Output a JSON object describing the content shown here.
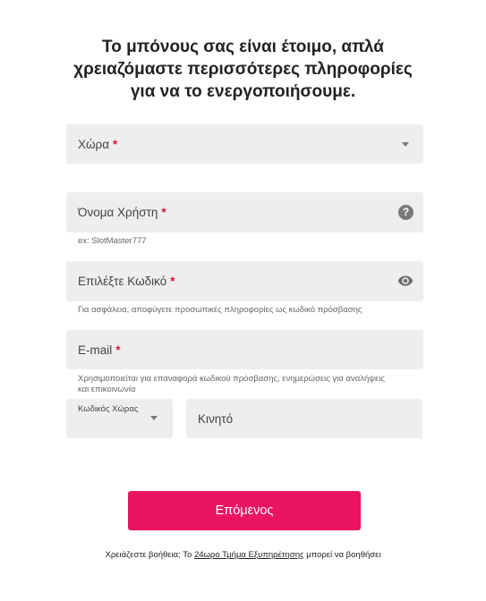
{
  "heading": {
    "line1": "Το μπόνους σας είναι έτοιμο, απλά",
    "line2": "χρειαζόμαστε περισσότερες πληροφορίες",
    "line3": "για να το ενεργοποιήσουμε."
  },
  "form": {
    "country": {
      "label": "Χώρα",
      "required_mark": "*"
    },
    "username": {
      "label": "Όνομα Χρήστη",
      "required_mark": "*",
      "hint": "ex: SlotMaster777",
      "help_icon": "question-circle-icon",
      "help_glyph": "?"
    },
    "password": {
      "label": "Επιλέξτε Κωδικό",
      "required_mark": "*",
      "hint": "Για ασφάλεια, αποφύγετε προσωπικές πληροφορίες ως κωδικό πρόσβασης",
      "toggle_icon": "eye-icon"
    },
    "email": {
      "label": "E-mail",
      "required_mark": "*",
      "hint_line1": "Χρησιμοποιείται για επαναφορά κωδικού πρόσβασης, ενημερώσεις για αναλήψεις",
      "hint_line2": "και επικοινωνία"
    },
    "country_code": {
      "label": "Κωδικός Χώρας"
    },
    "mobile": {
      "label": "Κινητό"
    }
  },
  "next_button": {
    "label": "Επόμενος"
  },
  "footer": {
    "prefix": "Χρειάζεστε βοήθεια; Το",
    "link": "24ωρο Τμήμα Εξυπηρέτησης",
    "suffix": "μπορεί να βοηθήσει"
  },
  "colors": {
    "accent": "#ea1460",
    "required": "#d8173a",
    "field_bg": "#eeeeee"
  }
}
